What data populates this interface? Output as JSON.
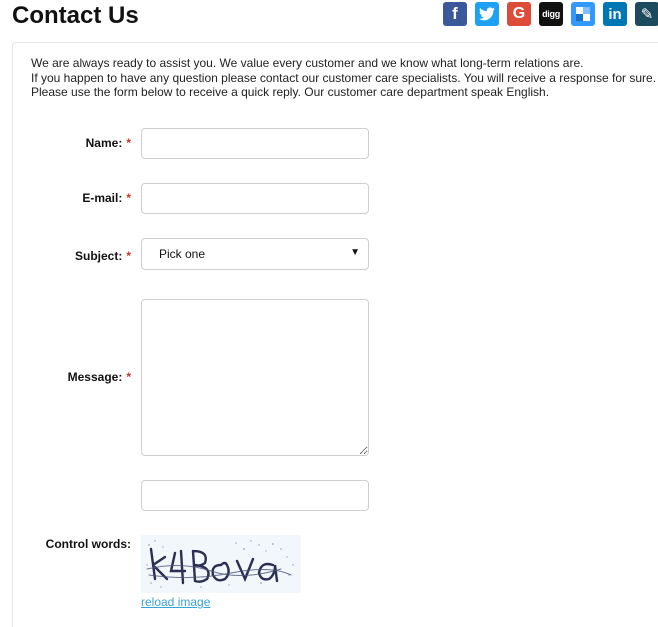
{
  "header": {
    "title": "Contact Us"
  },
  "social": [
    {
      "name": "facebook",
      "icon": "facebook-icon",
      "glyph": "f",
      "color": "#3b5998"
    },
    {
      "name": "twitter",
      "icon": "twitter-icon",
      "glyph": "",
      "color": "#1da1f2"
    },
    {
      "name": "google",
      "icon": "google-icon",
      "glyph": "G",
      "color": "#dd4b39"
    },
    {
      "name": "digg",
      "icon": "digg-icon",
      "glyph": "digg",
      "color": "#111111"
    },
    {
      "name": "delicious",
      "icon": "delicious-icon",
      "glyph": "",
      "color": "#3399ff"
    },
    {
      "name": "linkedin",
      "icon": "linkedin-icon",
      "glyph": "in",
      "color": "#0077b5"
    },
    {
      "name": "pencil",
      "icon": "pencil-icon",
      "glyph": "✎",
      "color": "#1e4a5e"
    }
  ],
  "intro": {
    "line1": "We are always ready to assist you. We value every customer and we know what long-term relations are.",
    "line2": "If you happen to have any question please contact our customer care specialists. You will receive a response for sure.",
    "line3": "Please use the form below to receive a quick reply. Our customer care department speak English."
  },
  "form": {
    "required_marker": "*",
    "name_label": "Name:",
    "name_value": "",
    "email_label": "E-mail:",
    "email_value": "",
    "subject_label": "Subject:",
    "subject_value": "Pick one",
    "message_label": "Message:",
    "message_value": "",
    "control_input_value": "",
    "control_label": "Control words:",
    "captcha_icon": "captcha-image",
    "captcha_text": "k4BOva",
    "reload_label": "reload image"
  },
  "colors": {
    "required": "#c0392b",
    "link": "#3aa3d6",
    "border": "#cfcfcf"
  }
}
